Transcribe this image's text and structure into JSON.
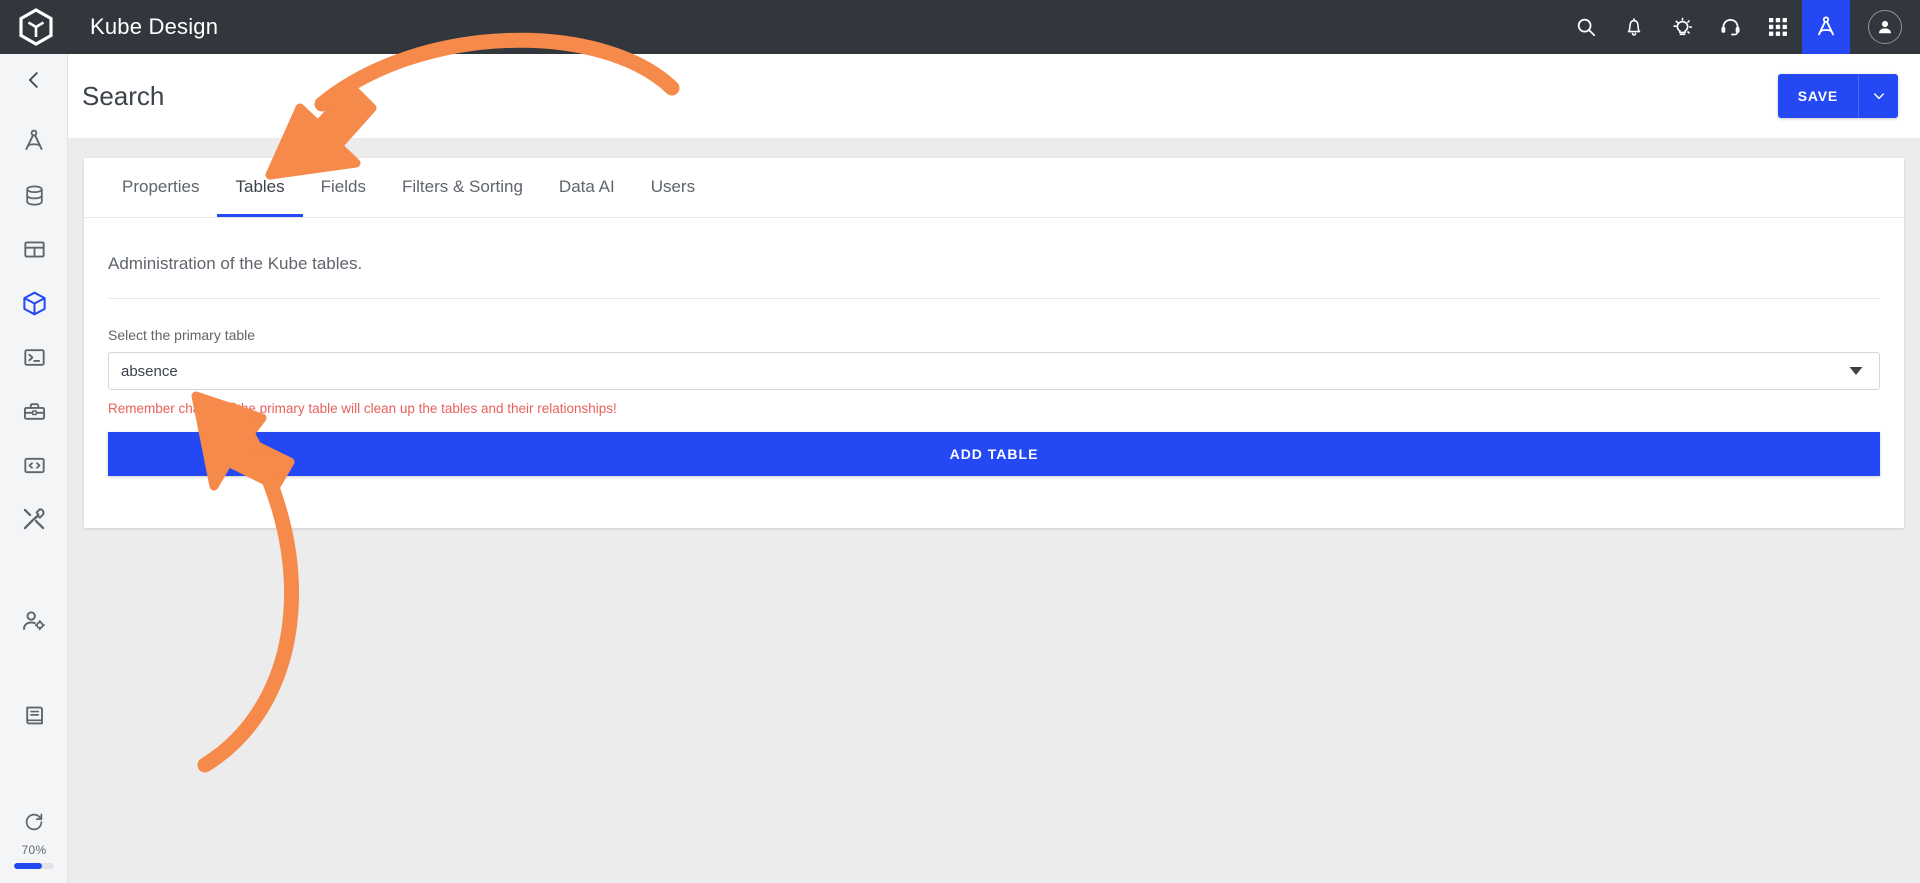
{
  "topbar": {
    "brand": "Kube Design",
    "logo_icon": "kube-cube-logo-icon",
    "icons": [
      {
        "name": "search-icon",
        "label": "Search"
      },
      {
        "name": "notifications-bell-icon",
        "label": "Notifications"
      },
      {
        "name": "lightbulb-idea-icon",
        "label": "Tips"
      },
      {
        "name": "headset-support-icon",
        "label": "Support"
      },
      {
        "name": "apps-grid-icon",
        "label": "Apps"
      },
      {
        "name": "design-compass-icon",
        "label": "Design"
      }
    ],
    "avatar_icon": "user-avatar-icon"
  },
  "sidebar": {
    "collapse_icon": "chevron-left-icon",
    "items": [
      {
        "icon": "design-compass-icon",
        "label": "Design"
      },
      {
        "icon": "database-icon",
        "label": "Database"
      },
      {
        "icon": "table-grid-icon",
        "label": "Tables"
      },
      {
        "icon": "cube-icon",
        "label": "Models",
        "active": true
      },
      {
        "icon": "terminal-console-icon",
        "label": "Console"
      },
      {
        "icon": "toolbox-icon",
        "label": "Toolbox"
      },
      {
        "icon": "code-brackets-icon",
        "label": "Code"
      },
      {
        "icon": "tools-wrench-screwdriver-icon",
        "label": "Tools"
      },
      {
        "icon": "user-settings-icon",
        "label": "User settings"
      },
      {
        "icon": "book-docs-icon",
        "label": "Documentation"
      }
    ],
    "footer": {
      "refresh_icon": "refresh-redo-icon",
      "percent_label": "70%",
      "percent_value": 70
    }
  },
  "header": {
    "title": "Search",
    "save_label": "SAVE",
    "save_caret_icon": "chevron-down-icon"
  },
  "tabs": [
    {
      "label": "Properties",
      "active": false
    },
    {
      "label": "Tables",
      "active": true
    },
    {
      "label": "Fields",
      "active": false
    },
    {
      "label": "Filters & Sorting",
      "active": false
    },
    {
      "label": "Data AI",
      "active": false
    },
    {
      "label": "Users",
      "active": false
    }
  ],
  "main": {
    "description": "Administration of the Kube tables.",
    "select_label": "Select the primary table",
    "select_value": "absence",
    "select_caret_icon": "dropdown-caret-icon",
    "warning": "Remember changing the primary table will clean up the tables and their relationships!",
    "add_table_label": "ADD TABLE"
  },
  "annotations": {
    "arrow_color": "#f58a4b",
    "arrows": [
      {
        "name": "arrow-to-tables-tab",
        "points_at": "Tables"
      },
      {
        "name": "arrow-to-primary-table-select",
        "points_at": "absence"
      }
    ]
  },
  "colors": {
    "topbar_bg": "#32373d",
    "accent_blue": "#2348f4",
    "page_bg": "#ececec",
    "warning_red": "#e8615c",
    "annotation_orange": "#f58a4b"
  }
}
